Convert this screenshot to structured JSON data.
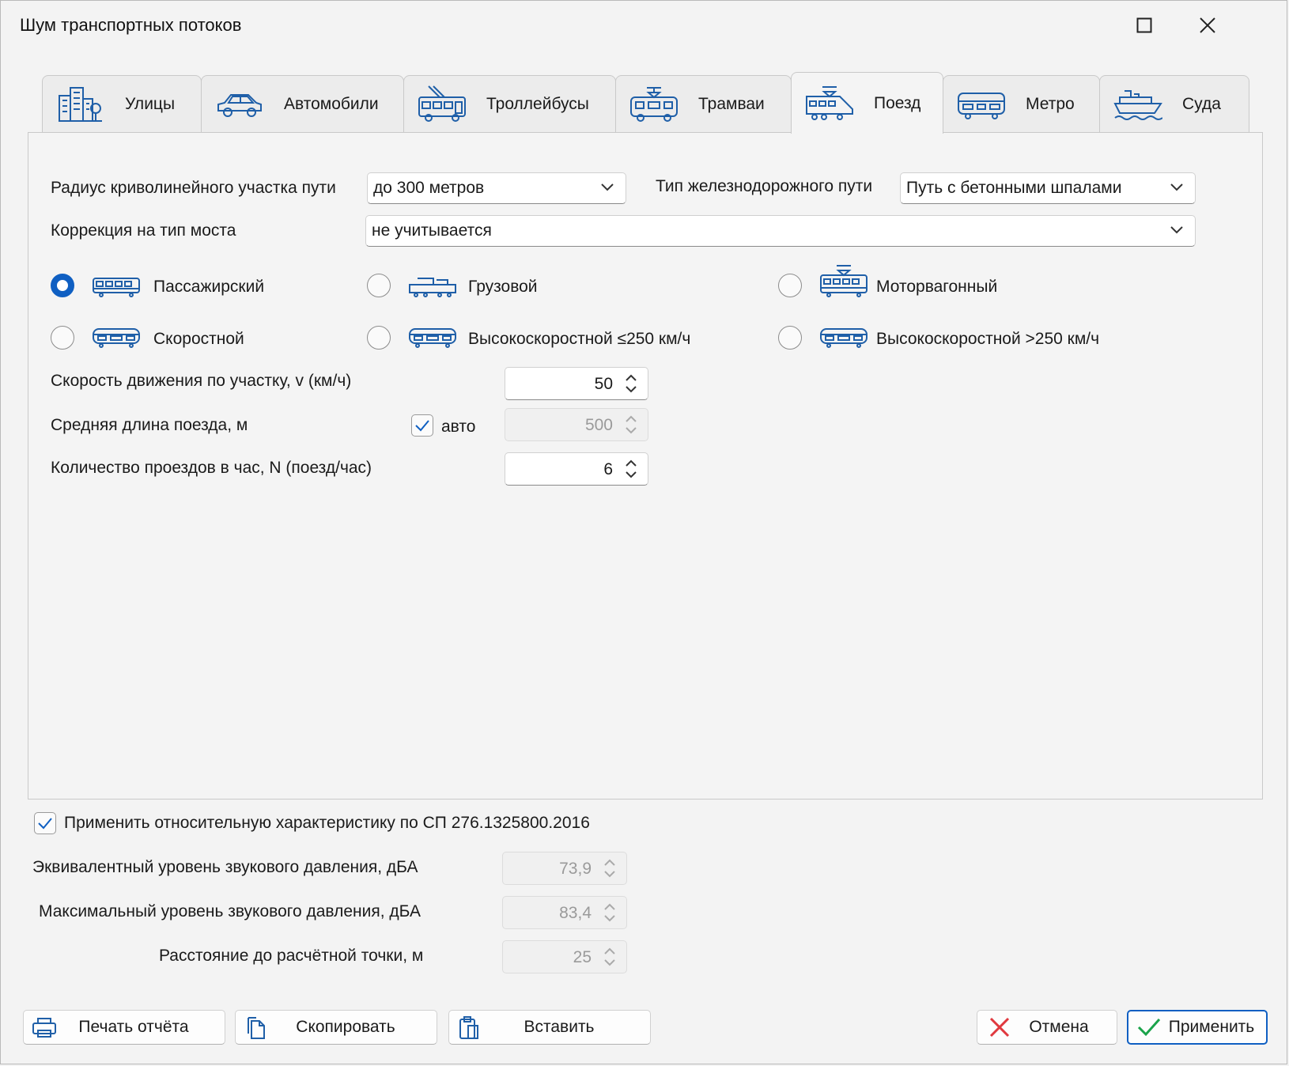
{
  "window": {
    "title": "Шум транспортных потоков"
  },
  "tabs": [
    {
      "label": "Улицы",
      "icon": "buildings-icon"
    },
    {
      "label": "Автомобили",
      "icon": "car-icon"
    },
    {
      "label": "Троллейбусы",
      "icon": "trolleybus-icon"
    },
    {
      "label": "Трамваи",
      "icon": "tram-icon"
    },
    {
      "label": "Поезд",
      "icon": "train-icon",
      "active": true
    },
    {
      "label": "Метро",
      "icon": "metro-icon"
    },
    {
      "label": "Суда",
      "icon": "ship-icon"
    }
  ],
  "form": {
    "radius_label": "Радиус криволинейного участка пути",
    "radius_value": "до 300 метров",
    "track_label": "Тип железнодорожного пути",
    "track_value": "Путь с бетонными шпалами",
    "bridge_label": "Коррекция на тип моста",
    "bridge_value": "не учитывается"
  },
  "train_types": [
    {
      "label": "Пассажирский",
      "selected": true
    },
    {
      "label": "Грузовой",
      "selected": false
    },
    {
      "label": "Моторвагонный",
      "selected": false
    },
    {
      "label": "Скоростной",
      "selected": false
    },
    {
      "label": "Высокоскоростной ≤250 км/ч",
      "selected": false
    },
    {
      "label": "Высокоскоростной >250 км/ч",
      "selected": false
    }
  ],
  "params": {
    "speed_label": "Скорость движения по участку, v (км/ч)",
    "speed_value": "50",
    "length_label": "Средняя длина поезда, м",
    "auto_label": "авто",
    "auto_checked": true,
    "length_value": "500",
    "count_label": "Количество проездов в час, N (поезд/час)",
    "count_value": "6"
  },
  "relative": {
    "apply_label": "Применить относительную характеристику по СП 276.1325800.2016",
    "apply_checked": true,
    "leq_label": "Эквивалентный уровень звукового давления, дБА",
    "leq_value": "73,9",
    "lmax_label": "Максимальный уровень звукового давления, дБА",
    "lmax_value": "83,4",
    "distance_label": "Расстояние до расчётной точки, м",
    "distance_value": "25"
  },
  "buttons": {
    "print": "Печать отчёта",
    "copy": "Скопировать",
    "paste": "Вставить",
    "cancel": "Отмена",
    "apply": "Применить"
  },
  "colors": {
    "accent": "#0f5fc2",
    "icon": "#1f5fa8",
    "cancel": "#e0383e",
    "ok": "#1aa34a"
  }
}
